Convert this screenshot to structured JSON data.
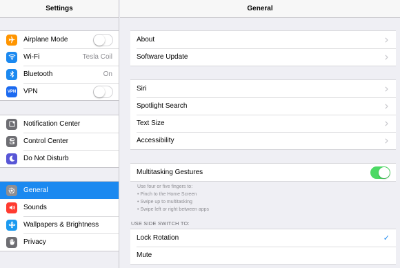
{
  "sidebar": {
    "title": "Settings",
    "groups": [
      [
        {
          "label": "Airplane Mode",
          "icon": "airplane-icon",
          "color": "#ff9500"
        },
        {
          "label": "Wi-Fi",
          "value": "Tesla Coil",
          "icon": "wifi-icon",
          "color": "#1b89f0"
        },
        {
          "label": "Bluetooth",
          "value": "On",
          "icon": "bluetooth-icon",
          "color": "#1b89f0"
        },
        {
          "label": "VPN",
          "icon": "vpn-icon",
          "color": "#1b6af0",
          "icon_text": "VPN"
        }
      ],
      [
        {
          "label": "Notification Center",
          "icon": "notification-center-icon",
          "color": "#6e6e73"
        },
        {
          "label": "Control Center",
          "icon": "control-center-icon",
          "color": "#6e6e73"
        },
        {
          "label": "Do Not Disturb",
          "icon": "moon-icon",
          "color": "#5856d6"
        }
      ],
      [
        {
          "label": "General",
          "icon": "gear-icon",
          "color": "#8e8e93"
        },
        {
          "label": "Sounds",
          "icon": "speaker-icon",
          "color": "#ff3b30"
        },
        {
          "label": "Wallpapers & Brightness",
          "icon": "flower-icon",
          "color": "#1b9af0"
        },
        {
          "label": "Privacy",
          "icon": "hand-icon",
          "color": "#6e6e73"
        }
      ]
    ],
    "airplane_mode_on": false,
    "vpn_on": false,
    "selected": "General"
  },
  "main": {
    "title": "General",
    "group1": [
      "About",
      "Software Update"
    ],
    "group2": [
      "Siri",
      "Spotlight Search",
      "Text Size",
      "Accessibility"
    ],
    "multitasking": {
      "label": "Multitasking Gestures",
      "on": true
    },
    "multitasking_hint": [
      "Use four or five fingers to:",
      "• Pinch to the Home Screen",
      "• Swipe up to multitasking",
      "• Swipe left or right between apps"
    ],
    "side_switch_title": "USE SIDE SWITCH TO:",
    "side_switch_options": [
      {
        "label": "Lock Rotation",
        "checked": true
      },
      {
        "label": "Mute",
        "checked": false
      }
    ]
  },
  "colors": {
    "accent": "#1b89f0",
    "toggle_on": "#4cd964"
  }
}
